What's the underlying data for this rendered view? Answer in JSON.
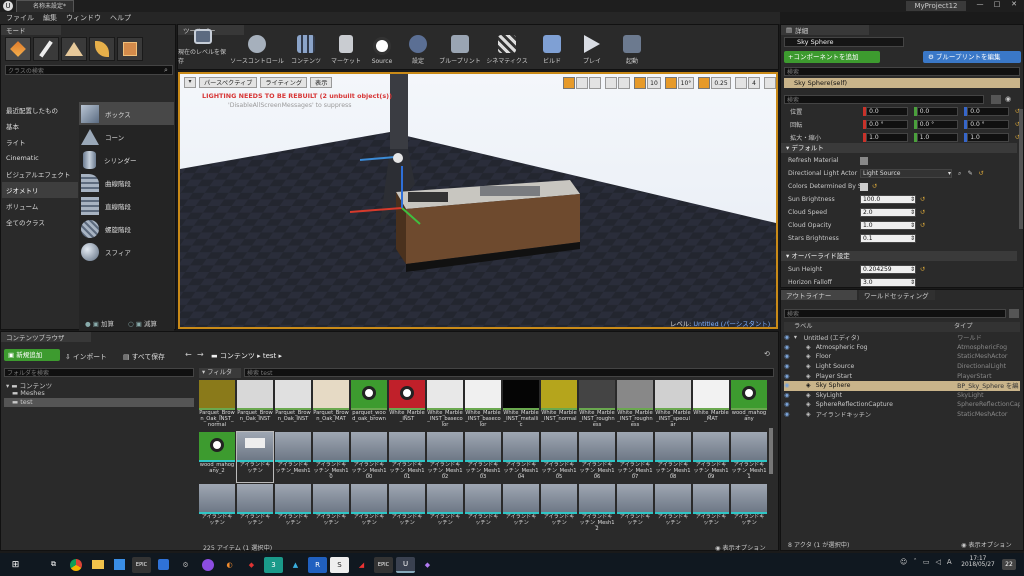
{
  "window": {
    "title": "名称未設定*",
    "project": "MyProject12"
  },
  "menu": [
    "ファイル",
    "編集",
    "ウィンドウ",
    "ヘルプ"
  ],
  "modes": {
    "tab": "モード",
    "search_placeholder": "クラスの検索",
    "categories": [
      "最近配置したもの",
      "基本",
      "ライト",
      "Cinematic",
      "ビジュアルエフェクト",
      "ジオメトリ",
      "ボリューム",
      "全てのクラス"
    ],
    "selected_category": "ジオメトリ",
    "items": [
      "ボックス",
      "コーン",
      "シリンダー",
      "曲線階段",
      "直線階段",
      "螺旋階段",
      "スフィア"
    ],
    "add": "加算",
    "subtract": "減算"
  },
  "toolbar": {
    "tab": "ツールバー",
    "buttons": [
      "現在のレベルを保存",
      "ソースコントロール",
      "コンテンツ",
      "マーケット",
      "Source",
      "設定",
      "ブループリント",
      "シネマティクス",
      "ビルド",
      "プレイ",
      "起動"
    ]
  },
  "viewport": {
    "perspective": "パースペクティブ",
    "lighting": "ライティング",
    "show": "表示",
    "warning": "LIGHTING NEEDS TO BE REBUILT (2 unbuilt object(s))",
    "suppress": "'DisableAllScreenMessages' to suppress",
    "grid_snap": "10",
    "rot_snap": "10°",
    "scale_snap": "0.25",
    "camera_speed": "4",
    "level_label": "レベル: ",
    "level_name": "Untitled (パーシスタント)"
  },
  "details": {
    "tab": "詳細",
    "name": "Sky Sphere",
    "add_component": "+コンポーネントを追加",
    "blueprint_edit": "ブループリントを編集",
    "search_placeholder": "検索",
    "self_item": "Sky Sphere(self)",
    "search2_placeholder": "検索",
    "transform": [
      {
        "label": "位置",
        "x": "0.0",
        "y": "0.0",
        "z": "0.0"
      },
      {
        "label": "回転",
        "x": "0.0 °",
        "y": "0.0 °",
        "z": "0.0 °"
      },
      {
        "label": "拡大・縮小",
        "x": "1.0",
        "y": "1.0",
        "z": "1.0"
      }
    ],
    "default_section": "デフォルト",
    "props": [
      {
        "label": "Refresh Material",
        "value": ""
      },
      {
        "label": "Directional Light Actor",
        "value": "Light Source"
      },
      {
        "label": "Colors Determined By Sun H",
        "value": ""
      },
      {
        "label": "Sun Brightness",
        "value": "100.0"
      },
      {
        "label": "Cloud Speed",
        "value": "2.0"
      },
      {
        "label": "Cloud Opacity",
        "value": "1.0"
      },
      {
        "label": "Stars Brightness",
        "value": "0.1"
      }
    ],
    "override_section": "オーバーライド設定",
    "override_props": [
      {
        "label": "Sun Height",
        "value": "0.204259"
      },
      {
        "label": "Horizon Falloff",
        "value": "3.0"
      }
    ]
  },
  "outliner": {
    "tab": "アウトライナー",
    "tab2": "ワールドセッティング",
    "search_placeholder": "検索",
    "col_label": "ラベル",
    "col_type": "タイプ",
    "rows": [
      {
        "name": "Untitled (エディタ)",
        "type": "ワールド"
      },
      {
        "name": "Atmospheric Fog",
        "type": "AtmosphericFog"
      },
      {
        "name": "Floor",
        "type": "StaticMeshActor"
      },
      {
        "name": "Light Source",
        "type": "DirectionalLight"
      },
      {
        "name": "Player Start",
        "type": "PlayerStart"
      },
      {
        "name": "Sky Sphere",
        "type": "BP_Sky_Sphere を編"
      },
      {
        "name": "SkyLight",
        "type": "SkyLight"
      },
      {
        "name": "SphereReflectionCapture",
        "type": "SphereReflectionCaptu"
      },
      {
        "name": "アイランドキッチン",
        "type": "StaticMeshActor"
      }
    ],
    "footer": "8 アクタ (1 が選択中)",
    "view_options": "表示オプション"
  },
  "content": {
    "tab": "コンテンツブラウザ",
    "add_new": "新規追加",
    "import": "インポート",
    "save_all": "すべて保存",
    "path_root": "コンテンツ",
    "path_leaf": "test",
    "folder_search": "フォルダを検索",
    "filter": "フィルタ",
    "search_placeholder": "検索 test",
    "tree": [
      "コンテンツ",
      "Meshes",
      "test"
    ],
    "row1": [
      "Parquet_Brown_Oak_INST_normal",
      "Parquet_Brown_Oak_INST",
      "Parquet_Brown_Oak_INST",
      "Parquet_Brown_Oak_MAT",
      "parquet_wood_oak_brown",
      "White_Marble_INST",
      "White_Marble_INST_basecolor",
      "White_Marble_INST_basecolor",
      "White_Marble_INST_metallic",
      "White_Marble_INST_normal",
      "White_Marble_INST_roughness",
      "White_Marble_INST_roughness",
      "White_Marble_INST_specular",
      "White_Marble_MAT",
      "wood_mahogany"
    ],
    "row2": [
      "wood_mahogany_2",
      "アイランドキッチン",
      "アイランドキッチン_Mesh1",
      "アイランドキッチン_Mesh10",
      "アイランドキッチン_Mesh100",
      "アイランドキッチン_Mesh101",
      "アイランドキッチン_Mesh102",
      "アイランドキッチン_Mesh103",
      "アイランドキッチン_Mesh104",
      "アイランドキッチン_Mesh105",
      "アイランドキッチン_Mesh106",
      "アイランドキッチン_Mesh107",
      "アイランドキッチン_Mesh108",
      "アイランドキッチン_Mesh109",
      "アイランドキッチン_Mesh11"
    ],
    "row3": [
      "アイランドキッチン",
      "アイランドキッチン",
      "アイランドキッチン",
      "アイランドキッチン",
      "アイランドキッチン",
      "アイランドキッチン",
      "アイランドキッチン",
      "アイランドキッチン",
      "アイランドキッチン",
      "アイランドキッチン",
      "アイランドキッチン_Mesh12",
      "アイランドキッチン",
      "アイランドキッチン",
      "アイランドキッチン",
      "アイランドキッチン"
    ],
    "count": "225 アイテム (1 選択中)",
    "view_options": "表示オプション"
  },
  "taskbar": {
    "time": "17:17",
    "date": "2018/05/27",
    "notif": "22"
  },
  "colors": {
    "accent": "#e8a33a",
    "green": "#3d9b2f",
    "blue": "#3a78c8",
    "warning": "#d73636"
  }
}
